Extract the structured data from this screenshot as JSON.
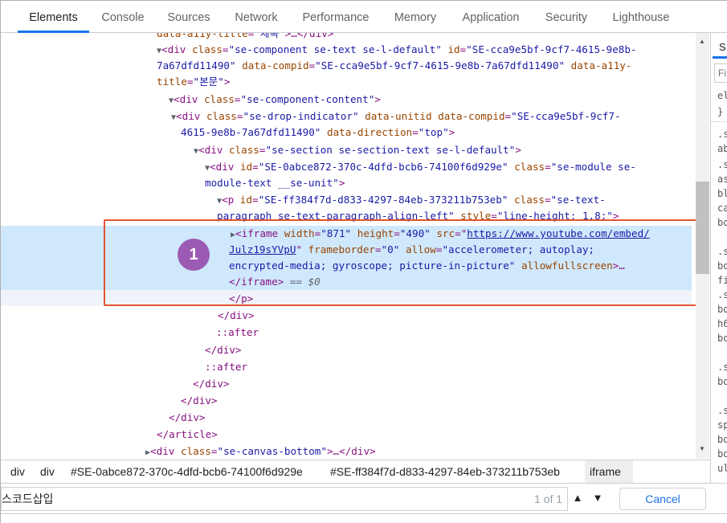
{
  "tabs": [
    {
      "label": "Elements",
      "active": true
    },
    {
      "label": "Console"
    },
    {
      "label": "Sources"
    },
    {
      "label": "Network"
    },
    {
      "label": "Performance"
    },
    {
      "label": "Memory"
    },
    {
      "label": "Application"
    },
    {
      "label": "Security"
    },
    {
      "label": "Lighthouse"
    }
  ],
  "tree": {
    "l0_t1": "data-a11y-title",
    "l0_t2": "=\"",
    "l0_v": "제목",
    "l0_t3": "\">…</div>",
    "l1_tag": "<div",
    "l1_a1": "class",
    "l1_v1": "\"se-component se-text se-l-default\"",
    "l1_a2": "id",
    "l1_v2": "\"SE-cca9e5bf-9cf7-4615-9e8b-",
    "l2_v2": "7a67dfd11490\"",
    "l2_a3": "data-compid",
    "l2_v3": "\"SE-cca9e5bf-9cf7-4615-9e8b-7a67dfd11490\"",
    "l2_a4": "data-a11y-",
    "l3_a4": "title",
    "l3_v4": "\"본문\"",
    "l4_tag": "<div",
    "l4_a1": "class",
    "l4_v1": "\"se-component-content\"",
    "l5_tag": "<div",
    "l5_a1": "class",
    "l5_v1": "\"se-drop-indicator\"",
    "l5_a2": "data-unitid",
    "l5_a3": "data-compid",
    "l5_v3": "\"SE-cca9e5bf-9cf7-",
    "l6_v3": "4615-9e8b-7a67dfd11490\"",
    "l6_a4": "data-direction",
    "l6_v4": "\"top\"",
    "l7_tag": "<div",
    "l7_a1": "class",
    "l7_v1": "\"se-section se-section-text se-l-default\"",
    "l8_tag": "<div",
    "l8_a1": "id",
    "l8_v1": "\"SE-0abce872-370c-4dfd-bcb6-74100f6d929e\"",
    "l8_a2": "class",
    "l8_v2": "\"se-module se-",
    "l9_v2": "module-text __se-unit\"",
    "l10_tag": "<p",
    "l10_a1": "id",
    "l10_v1": "\"SE-ff384f7d-d833-4297-84eb-373211b753eb\"",
    "l10_a2": "class",
    "l10_v2": "\"se-text-",
    "l11_v2": "paragraph se-text-paragraph-align-left\"",
    "l11_a3": "style",
    "l11_v3": "\"line-height: 1.8;\"",
    "l12_tag": "<iframe",
    "l12_a1": "width",
    "l12_v1": "\"871\"",
    "l12_a2": "height",
    "l12_v2": "\"490\"",
    "l12_a3": "src",
    "l12_link1": "https://www.youtube.com/embed/",
    "l13_link2": "Julz19sYVpU",
    "l13_a4": "frameborder",
    "l13_v4": "\"0\"",
    "l13_a5": "allow",
    "l13_v5": "\"accelerometer; autoplay;",
    "l14_v5": "encrypted-media; gyroscope; picture-in-picture\"",
    "l14_a6": "allowfullscreen",
    "l14_end": ">…",
    "l15_close": "</iframe>",
    "l15_dollar": "== $0",
    "l16": "</p>",
    "l17": "</div>",
    "l18": "::after",
    "l19": "</div>",
    "l20": "::after",
    "l21": "</div>",
    "l22": "</div>",
    "l23": "</div>",
    "l24": "</article>",
    "l25_tag": "<div",
    "l25_a1": "class",
    "l25_v1": "\"se-canvas-bottom\"",
    "l25_end": ">…</div>"
  },
  "annotation": {
    "badge": "1",
    "color": "#e2552f",
    "badge_color": "#9b5bb5"
  },
  "breadcrumbs": [
    "div",
    "div",
    "#SE-0abce872-370c-4dfd-bcb6-74100f6d929e",
    "#SE-ff384f7d-d833-4297-84eb-373211b753eb",
    "iframe"
  ],
  "search": {
    "value": "스코드삽입",
    "count": "1 of 1",
    "cancel": "Cancel"
  },
  "styles_panel": {
    "tab": "S",
    "filter": "Fi",
    "lines": [
      "el",
      "}",
      ".s",
      "ab",
      ".s",
      "as",
      "bl",
      "ca",
      "bo",
      ".s",
      "bo",
      "fi",
      ".s",
      "bo",
      "h6",
      "bo",
      ".s",
      "bo",
      ".s",
      "sp",
      "bo",
      "bo",
      "ul"
    ]
  }
}
